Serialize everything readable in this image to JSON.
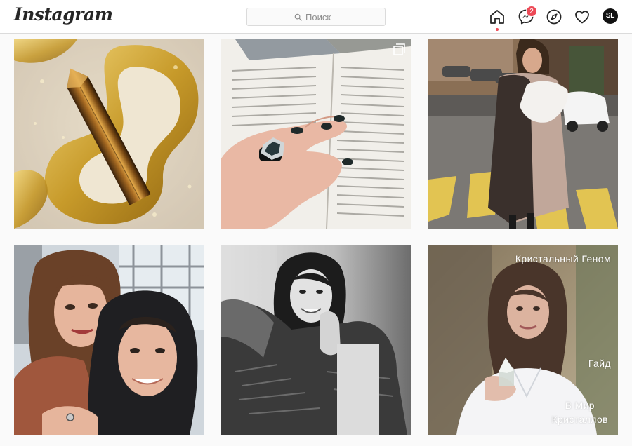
{
  "header": {
    "logo": "Instagram",
    "search_placeholder": "Поиск",
    "messages_badge": "2",
    "avatar_initials": "SL"
  },
  "posts": [
    {
      "id": "crystal-gold",
      "overlay": []
    },
    {
      "id": "book-ring",
      "overlay": [],
      "carousel": true
    },
    {
      "id": "street-coat",
      "overlay": []
    },
    {
      "id": "couple-selfie",
      "overlay": []
    },
    {
      "id": "bw-portrait",
      "overlay": []
    },
    {
      "id": "crystal-guide",
      "overlay": [
        "Кристальный Геном",
        "Гайд",
        "В Мир",
        "Кристаллов"
      ]
    }
  ],
  "colors": {
    "header_bg": "#ffffff",
    "page_bg": "#fafafa",
    "border": "#dbdbdb",
    "notification": "#ed4956"
  },
  "icons": [
    "search-icon",
    "home-icon",
    "messenger-icon",
    "explore-icon",
    "heart-icon",
    "carousel-icon"
  ]
}
